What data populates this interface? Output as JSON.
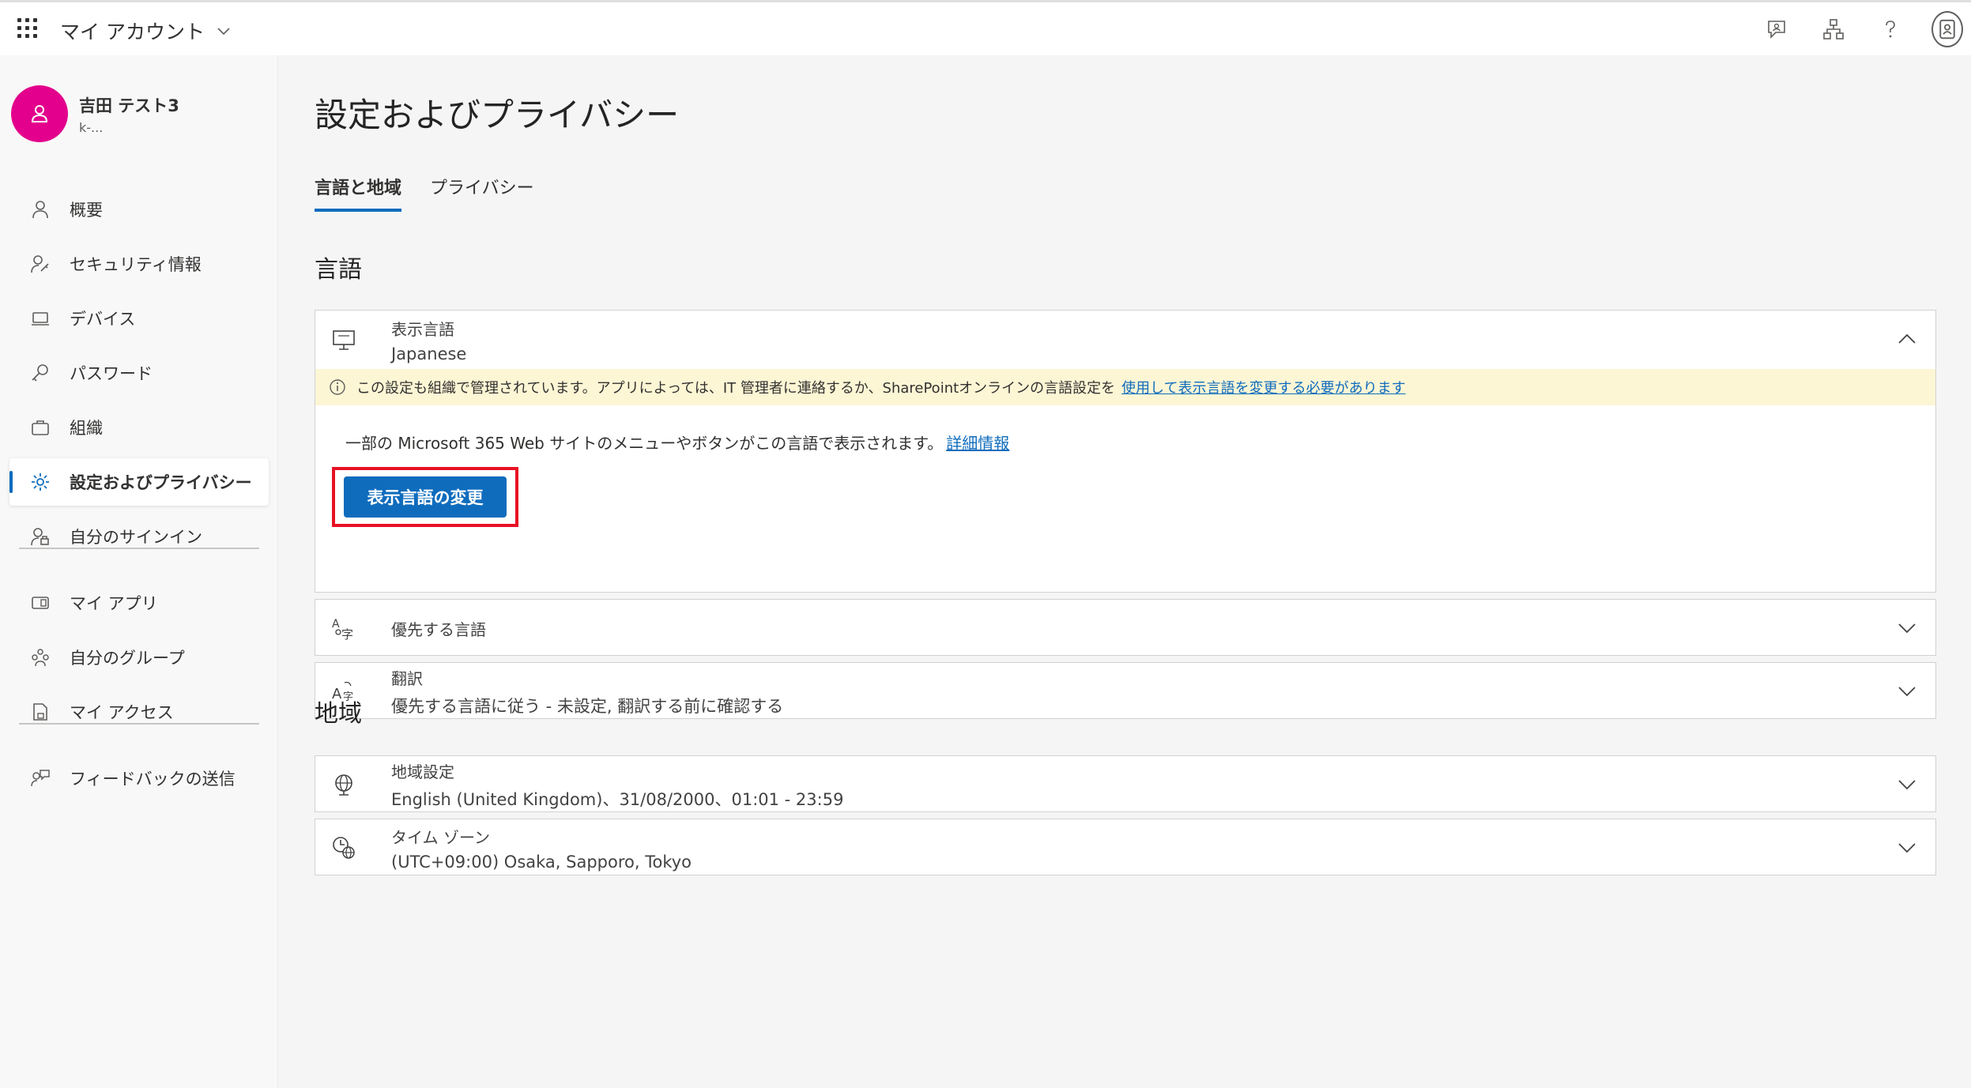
{
  "header": {
    "app_title": "マイ アカウント"
  },
  "profile": {
    "name": "吉田 テスト3",
    "sub": "k-..."
  },
  "sidebar": {
    "items": [
      {
        "label": "概要"
      },
      {
        "label": "セキュリティ情報"
      },
      {
        "label": "デバイス"
      },
      {
        "label": "パスワード"
      },
      {
        "label": "組織"
      },
      {
        "label": "設定およびプライバシー"
      },
      {
        "label": "自分のサインイン"
      },
      {
        "label": "マイ アプリ"
      },
      {
        "label": "自分のグループ"
      },
      {
        "label": "マイ アクセス"
      },
      {
        "label": "フィードバックの送信"
      }
    ]
  },
  "main": {
    "title": "設定およびプライバシー",
    "tabs": [
      {
        "label": "言語と地域"
      },
      {
        "label": "プライバシー"
      }
    ],
    "language_section": "言語",
    "region_section": "地域",
    "display_language": {
      "label": "表示言語",
      "value": "Japanese",
      "notice_text": "この設定も組織で管理されています。アプリによっては、IT 管理者に連絡するか、SharePointオンラインの言語設定を",
      "notice_link": "使用して表示言語を変更する必要があります",
      "body_text": "一部の Microsoft 365 Web サイトのメニューやボタンがこの言語で表示されます。",
      "body_link": "詳細情報",
      "button": "表示言語の変更"
    },
    "preferred_language": {
      "label": "優先する言語"
    },
    "translation": {
      "label": "翻訳",
      "value": "優先する言語に従う - 未設定, 翻訳する前に確認する"
    },
    "regional_settings": {
      "label": "地域設定",
      "value": "English (United Kingdom)、31/08/2000、01:01 - 23:59"
    },
    "time_zone": {
      "label": "タイム ゾーン",
      "value": "(UTC+09:00) Osaka, Sapporo, Tokyo"
    }
  },
  "colors": {
    "accent": "#0f6cbd",
    "avatar": "#e3008c",
    "highlight": "#e81123",
    "notice_bg": "#fdf6d5"
  }
}
